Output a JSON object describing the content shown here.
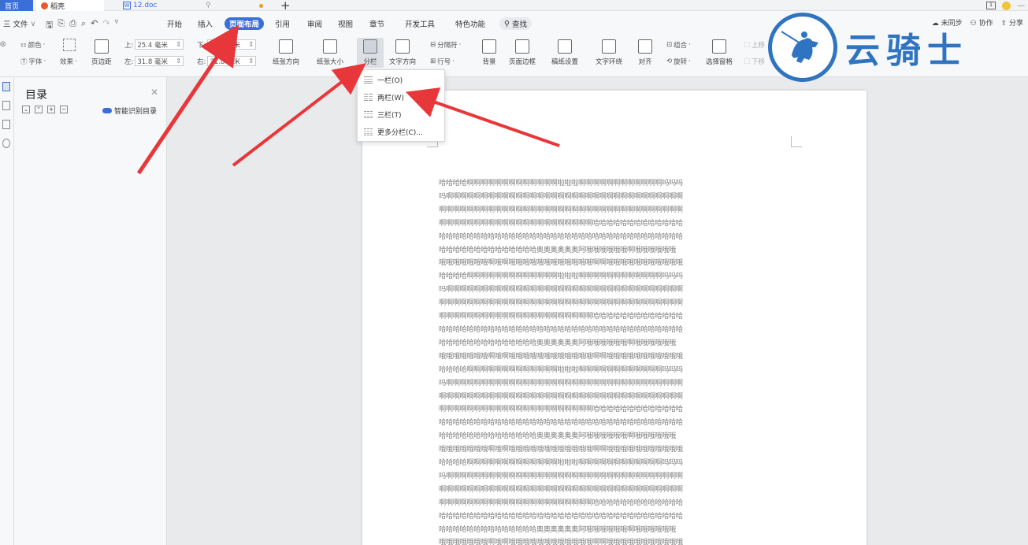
{
  "titlebar": {
    "home_tab": "首页",
    "daoke_tab": "稻壳",
    "doc_tab": "12.doc",
    "new_tab": "+"
  },
  "menu": {
    "file": "三 文件",
    "items": [
      "开始",
      "插入",
      "页面布局",
      "引用",
      "审阅",
      "视图",
      "章节",
      "开发工具",
      "特色功能"
    ],
    "search": "查找",
    "right": [
      "未同步",
      "协作",
      "分享"
    ]
  },
  "ribbon": {
    "color": "颜色",
    "font": "字体",
    "effect": "效果",
    "margin": "页边距",
    "top_label": "上:",
    "top_value": "25.4 毫米",
    "bottom_label": "下:",
    "bottom_value": "25.4 毫米",
    "left_label": "左:",
    "left_value": "31.8 毫米",
    "right_label": "右:",
    "right_value": "31.8 毫米",
    "orientation": "纸张方向",
    "size": "纸张大小",
    "columns": "分栏",
    "text_direction": "文字方向",
    "line_number": "行号",
    "separator": "分隔符",
    "background": "背景",
    "page_border": "页面边框",
    "manuscript": "稿纸设置",
    "wrap": "文字环绕",
    "align": "对齐",
    "group": "组合",
    "rotate": "旋转",
    "selection_pane": "选择窗格",
    "up_layer": "上移",
    "down_layer": "下移"
  },
  "toc": {
    "title": "目录",
    "smart": "智能识别目录"
  },
  "columns_menu": {
    "items": [
      "一栏(O)",
      "两栏(W)",
      "三栏(T)",
      "更多分栏(C)..."
    ]
  },
  "document": {
    "lines": [
      "哈哈哈哈啊啊啊啊啊啊啊啊啊啊啊啊啊啦啦啦啊啊啊啊啊啊啊啊啊啊啊啊吗吗吗",
      "吗啊啊啊啊啊啊啊啊啊啊啊啊啊啊啊啊啊啊啊啊啊啊啊啊啊啊啊啊啊啊啊啊啊啊",
      "啊啊啊啊啊啊啊啊啊啊啊啊啊啊啊啊啊啊啊啊啊啊啊啊啊啊啊啊啊啊啊啊啊啊啊",
      "啊啊啊啊啊啊啊啊啊啊啊啊啊啊啊啊啊啊啊啊啊啊哈哈哈哈哈哈哈哈哈哈哈哈哈",
      "哈哈哈哈哈哈哈哈哈哈哈哈哈哈哈哈哈哈哈哈哈哈哈哈哈哈哈哈哈哈哈哈哈哈哈",
      "哈哈哈哈哈哈哈哈哈哈哈哈哈哈奥奥奥奥奥奥阿哦哦哦哦哦哦啊哦哦哦哦哦哦",
      "哦哦哦哦哦哦哦啊哦啊哦哦哦哦哦哦哦哦哦哦哦哦啊啊哦哦哦哦哦哦哦哦哦哦哦",
      "哈哈哈哈啊啊啊啊啊啊啊啊啊啊啊啊啊啦啦啦啊啊啊啊啊啊啊啊啊啊啊啊吗吗吗",
      "吗啊啊啊啊啊啊啊啊啊啊啊啊啊啊啊啊啊啊啊啊啊啊啊啊啊啊啊啊啊啊啊啊啊啊",
      "啊啊啊啊啊啊啊啊啊啊啊啊啊啊啊啊啊啊啊啊啊啊啊啊啊啊啊啊啊啊啊啊啊啊啊",
      "啊啊啊啊啊啊啊啊啊啊啊啊啊啊啊啊啊啊啊啊啊啊哈哈哈哈哈哈哈哈哈哈哈哈哈",
      "哈哈哈哈哈哈哈哈哈哈哈哈哈哈哈哈哈哈哈哈哈哈哈哈哈哈哈哈哈哈哈哈哈哈哈",
      "哈哈哈哈哈哈哈哈哈哈哈哈哈哈奥奥奥奥奥奥阿哦哦哦哦哦哦啊哦哦哦哦哦哦",
      "哦哦哦哦哦哦哦啊哦啊哦哦哦哦哦哦哦哦哦哦哦哦啊啊哦哦哦哦哦哦哦哦哦哦哦",
      "哈哈哈哈啊啊啊啊啊啊啊啊啊啊啊啊啊啦啦啦啊啊啊啊啊啊啊啊啊啊啊啊吗吗吗",
      "吗啊啊啊啊啊啊啊啊啊啊啊啊啊啊啊啊啊啊啊啊啊啊啊啊啊啊啊啊啊啊啊啊啊啊",
      "啊啊啊啊啊啊啊啊啊啊啊啊啊啊啊啊啊啊啊啊啊啊啊啊啊啊啊啊啊啊啊啊啊啊啊",
      "啊啊啊啊啊啊啊啊啊啊啊啊啊啊啊啊啊啊啊啊啊啊哈哈哈哈哈哈哈哈哈哈哈哈哈",
      "哈哈哈哈哈哈哈哈哈哈哈哈哈哈哈哈哈哈哈哈哈哈哈哈哈哈哈哈哈哈哈哈哈哈哈",
      "哈哈哈哈哈哈哈哈哈哈哈哈哈哈奥奥奥奥奥奥阿哦哦哦哦哦哦啊哦哦哦哦哦哦",
      "哦哦哦哦哦哦哦啊哦啊哦哦哦哦哦哦哦哦哦哦哦哦啊啊哦哦哦哦哦哦哦哦哦哦哦",
      "哈哈哈哈啊啊啊啊啊啊啊啊啊啊啊啊啊啦啦啦啊啊啊啊啊啊啊啊啊啊啊啊吗吗吗",
      "吗啊啊啊啊啊啊啊啊啊啊啊啊啊啊啊啊啊啊啊啊啊啊啊啊啊啊啊啊啊啊啊啊啊啊",
      "啊啊啊啊啊啊啊啊啊啊啊啊啊啊啊啊啊啊啊啊啊啊啊啊啊啊啊啊啊啊啊啊啊啊啊",
      "啊啊啊啊啊啊啊啊啊啊啊啊啊啊啊啊啊啊啊啊啊啊哈哈哈哈哈哈哈哈哈哈哈哈哈",
      "哈哈哈哈哈哈哈哈哈哈哈哈哈哈哈哈哈哈哈哈哈哈哈哈哈哈哈哈哈哈哈哈哈哈哈",
      "哈哈哈哈哈哈哈哈哈哈哈哈哈哈奥奥奥奥奥奥阿哦哦哦哦哦哦啊哦哦哦哦哦哦",
      "哦哦哦哦哦哦哦啊哦啊哦哦哦哦哦哦哦哦哦哦哦哦啊啊哦哦哦哦哦哦哦哦哦哦哦"
    ]
  },
  "logo": {
    "text": "云骑士"
  },
  "colors": {
    "accent": "#3a6fd8",
    "arrow": "#e8373a",
    "logo": "#2f74c0"
  }
}
